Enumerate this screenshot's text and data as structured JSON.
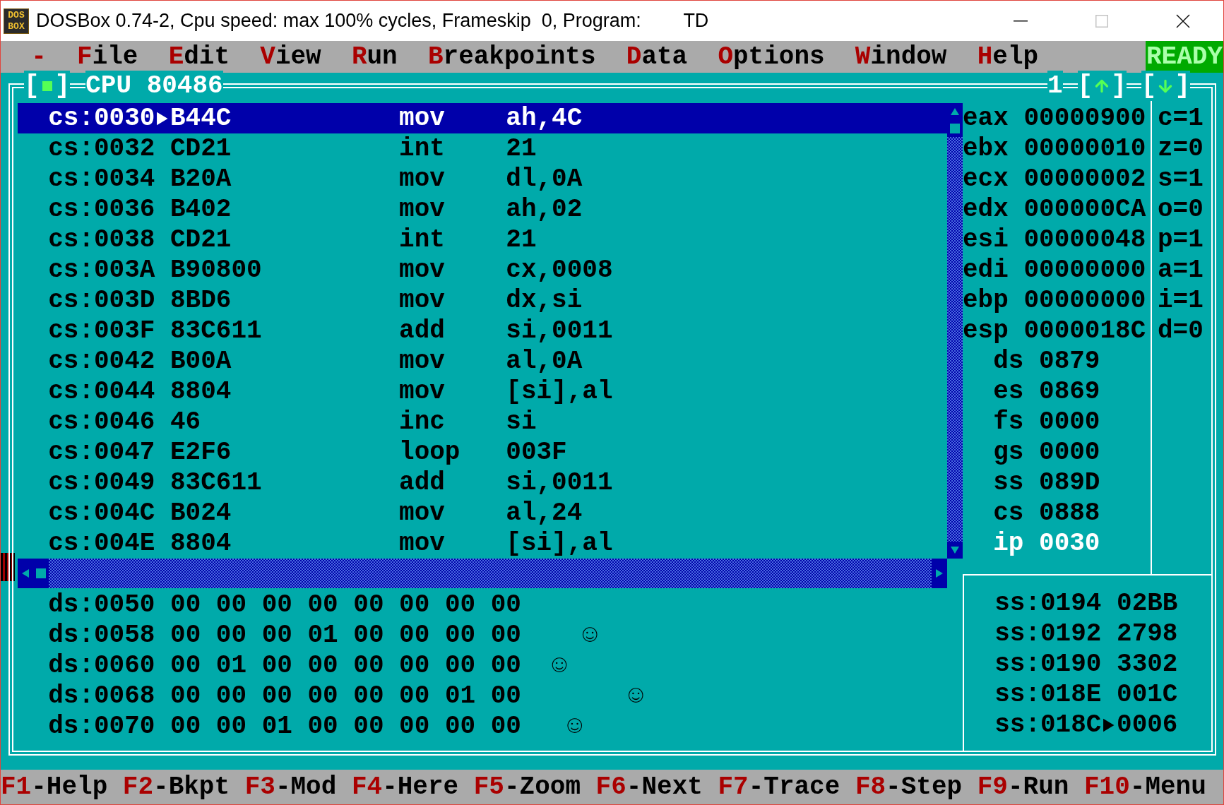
{
  "window": {
    "logo_lines": [
      "DOS",
      "BOX"
    ],
    "title": "DOSBox 0.74-2, Cpu speed: max 100% cycles, Frameskip  0, Program:        TD",
    "controls": [
      {
        "kind": "minimize",
        "disabled": false
      },
      {
        "kind": "maximize",
        "disabled": true
      },
      {
        "kind": "close",
        "disabled": false
      }
    ]
  },
  "menu": {
    "system": "-",
    "items": [
      {
        "hotkey": "F",
        "rest": "ile"
      },
      {
        "hotkey": "E",
        "rest": "dit"
      },
      {
        "hotkey": "V",
        "rest": "iew"
      },
      {
        "hotkey": "R",
        "rest": "un"
      },
      {
        "hotkey": "B",
        "rest": "reakpoints"
      },
      {
        "hotkey": "D",
        "rest": "ata"
      },
      {
        "hotkey": "O",
        "rest": "ptions"
      },
      {
        "hotkey": "W",
        "rest": "indow"
      },
      {
        "hotkey": "H",
        "rest": "elp"
      }
    ],
    "status": "READY"
  },
  "cpu_window": {
    "close_button": {
      "open": "[",
      "close": "]"
    },
    "title": "CPU 80486",
    "window_number": "1",
    "zoom_buttons": [
      {
        "kind": "up",
        "open": "[",
        "close": "]"
      },
      {
        "kind": "down",
        "open": "[",
        "close": "]"
      }
    ],
    "code_rows": [
      {
        "address": "cs:0030",
        "bytes": "B44C",
        "mnemonic": "mov",
        "operands": "ah,4C",
        "selected": true,
        "current": true
      },
      {
        "address": "cs:0032",
        "bytes": "CD21",
        "mnemonic": "int",
        "operands": "21",
        "selected": false,
        "current": false
      },
      {
        "address": "cs:0034",
        "bytes": "B20A",
        "mnemonic": "mov",
        "operands": "dl,0A",
        "selected": false,
        "current": false
      },
      {
        "address": "cs:0036",
        "bytes": "B402",
        "mnemonic": "mov",
        "operands": "ah,02",
        "selected": false,
        "current": false
      },
      {
        "address": "cs:0038",
        "bytes": "CD21",
        "mnemonic": "int",
        "operands": "21",
        "selected": false,
        "current": false
      },
      {
        "address": "cs:003A",
        "bytes": "B90800",
        "mnemonic": "mov",
        "operands": "cx,0008",
        "selected": false,
        "current": false
      },
      {
        "address": "cs:003D",
        "bytes": "8BD6",
        "mnemonic": "mov",
        "operands": "dx,si",
        "selected": false,
        "current": false
      },
      {
        "address": "cs:003F",
        "bytes": "83C611",
        "mnemonic": "add",
        "operands": "si,0011",
        "selected": false,
        "current": false
      },
      {
        "address": "cs:0042",
        "bytes": "B00A",
        "mnemonic": "mov",
        "operands": "al,0A",
        "selected": false,
        "current": false
      },
      {
        "address": "cs:0044",
        "bytes": "8804",
        "mnemonic": "mov",
        "operands": "[si],al",
        "selected": false,
        "current": false
      },
      {
        "address": "cs:0046",
        "bytes": "46",
        "mnemonic": "inc",
        "operands": "si",
        "selected": false,
        "current": false
      },
      {
        "address": "cs:0047",
        "bytes": "E2F6",
        "mnemonic": "loop",
        "operands": "003F",
        "selected": false,
        "current": false
      },
      {
        "address": "cs:0049",
        "bytes": "83C611",
        "mnemonic": "add",
        "operands": "si,0011",
        "selected": false,
        "current": false
      },
      {
        "address": "cs:004C",
        "bytes": "B024",
        "mnemonic": "mov",
        "operands": "al,24",
        "selected": false,
        "current": false
      },
      {
        "address": "cs:004E",
        "bytes": "8804",
        "mnemonic": "mov",
        "operands": "[si],al",
        "selected": false,
        "current": false
      }
    ],
    "registers": [
      {
        "kind": "general",
        "name": "eax",
        "value": "00000900",
        "changed": false
      },
      {
        "kind": "general",
        "name": "ebx",
        "value": "00000010",
        "changed": false
      },
      {
        "kind": "general",
        "name": "ecx",
        "value": "00000002",
        "changed": false
      },
      {
        "kind": "general",
        "name": "edx",
        "value": "000000CA",
        "changed": false
      },
      {
        "kind": "general",
        "name": "esi",
        "value": "00000048",
        "changed": false
      },
      {
        "kind": "general",
        "name": "edi",
        "value": "00000000",
        "changed": false
      },
      {
        "kind": "general",
        "name": "ebp",
        "value": "00000000",
        "changed": false
      },
      {
        "kind": "general",
        "name": "esp",
        "value": "0000018C",
        "changed": false
      },
      {
        "kind": "segment",
        "name": "ds",
        "value": "0879",
        "changed": false
      },
      {
        "kind": "segment",
        "name": "es",
        "value": "0869",
        "changed": false
      },
      {
        "kind": "segment",
        "name": "fs",
        "value": "0000",
        "changed": false
      },
      {
        "kind": "segment",
        "name": "gs",
        "value": "0000",
        "changed": false
      },
      {
        "kind": "segment",
        "name": "ss",
        "value": "089D",
        "changed": false
      },
      {
        "kind": "segment",
        "name": "cs",
        "value": "0888",
        "changed": false
      },
      {
        "kind": "segment",
        "name": "ip",
        "value": "0030",
        "changed": true
      }
    ],
    "flags": [
      "c=1",
      "z=0",
      "s=1",
      "o=0",
      "p=1",
      "a=1",
      "i=1",
      "d=0"
    ],
    "dump_rows": [
      {
        "address": "ds:0050",
        "bytes": [
          "00",
          "00",
          "00",
          "00",
          "00",
          "00",
          "00",
          "00"
        ]
      },
      {
        "address": "ds:0058",
        "bytes": [
          "00",
          "00",
          "00",
          "01",
          "00",
          "00",
          "00",
          "00"
        ],
        "ascii": "   ☺"
      },
      {
        "address": "ds:0060",
        "bytes": [
          "00",
          "01",
          "00",
          "00",
          "00",
          "00",
          "00",
          "00"
        ],
        "ascii": " ☺"
      },
      {
        "address": "ds:0068",
        "bytes": [
          "00",
          "00",
          "00",
          "00",
          "00",
          "00",
          "01",
          "00"
        ],
        "ascii": "      ☺"
      },
      {
        "address": "ds:0070",
        "bytes": [
          "00",
          "00",
          "01",
          "00",
          "00",
          "00",
          "00",
          "00"
        ],
        "ascii": "  ☺"
      }
    ],
    "stack_rows": [
      {
        "address": "ss:0194",
        "value": "02BB",
        "current": false
      },
      {
        "address": "ss:0192",
        "value": "2798",
        "current": false
      },
      {
        "address": "ss:0190",
        "value": "3302",
        "current": false
      },
      {
        "address": "ss:018E",
        "value": "001C",
        "current": false
      },
      {
        "address": "ss:018C",
        "value": "0006",
        "current": true
      }
    ]
  },
  "function_keys": [
    {
      "key": "F1",
      "label": "-Help"
    },
    {
      "key": "F2",
      "label": "-Bkpt"
    },
    {
      "key": "F3",
      "label": "-Mod"
    },
    {
      "key": "F4",
      "label": "-Here"
    },
    {
      "key": "F5",
      "label": "-Zoom"
    },
    {
      "key": "F6",
      "label": "-Next"
    },
    {
      "key": "F7",
      "label": "-Trace"
    },
    {
      "key": "F8",
      "label": "-Step"
    },
    {
      "key": "F9",
      "label": "-Run"
    },
    {
      "key": "F10",
      "label": "-Menu"
    }
  ]
}
